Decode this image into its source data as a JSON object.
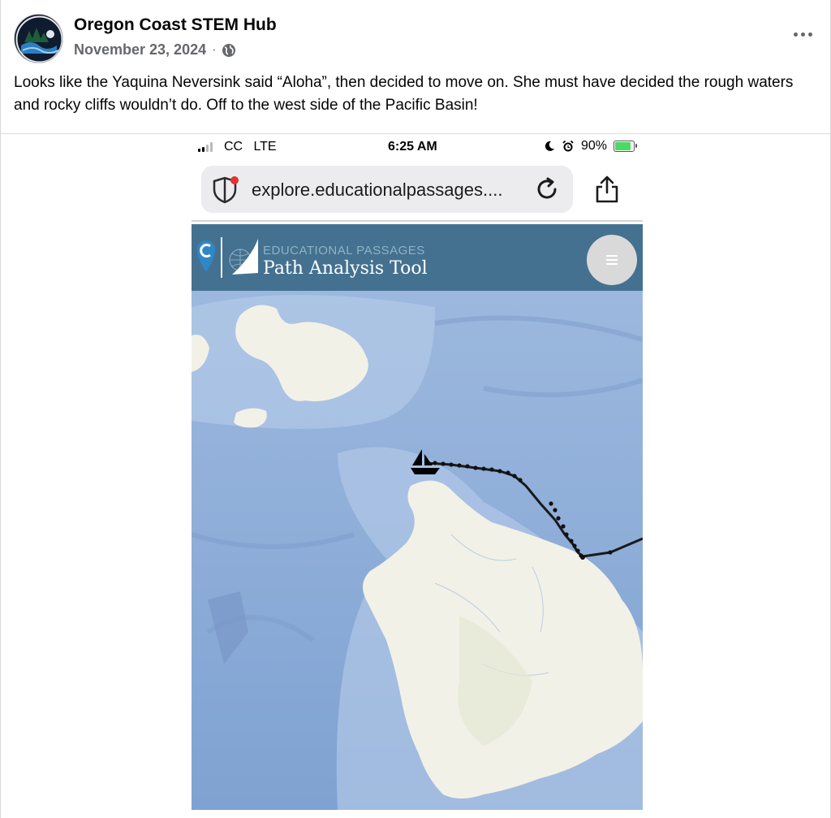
{
  "post": {
    "author": "Oregon Coast STEM Hub",
    "date": "November 23, 2024",
    "separator": "·",
    "privacy_icon": "globe-icon",
    "more_icon": "more-options-icon",
    "text": "Looks like the Yaquina Neversink said “Aloha”, then decided to move on. She must have decided the rough waters and rocky cliffs wouldn’t do. Off to the west side of the Pacific Basin!"
  },
  "phone": {
    "status": {
      "carrier": "CC   LTE",
      "time": "6:25 AM",
      "battery": "90%",
      "battery_level": 0.9
    },
    "browser": {
      "url": "explore.educationalpassages....",
      "shield_icon": "shield-icon",
      "reload_icon": "reload-icon",
      "share_icon": "share-icon"
    },
    "app": {
      "brand_small": "EDUCATIONAL PASSAGES",
      "brand_title": "Path Analysis Tool",
      "menu_icon": "hamburger-menu-icon",
      "header_color": "#447190"
    },
    "map": {
      "boat_icon": "sailboat-icon",
      "track_color": "#1a1a1a",
      "ocean_color": "#8fb0dc",
      "land_color": "#f2f1e7"
    }
  }
}
